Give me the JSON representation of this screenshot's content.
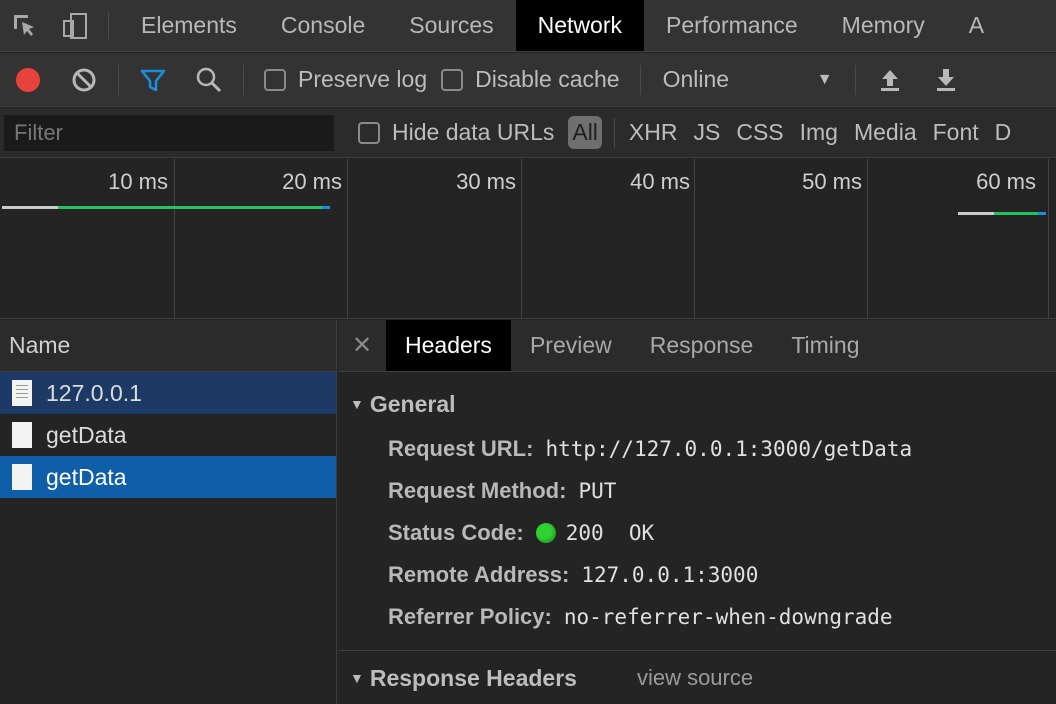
{
  "panels": {
    "tabs": [
      {
        "label": "Elements"
      },
      {
        "label": "Console"
      },
      {
        "label": "Sources"
      },
      {
        "label": "Network",
        "active": true
      },
      {
        "label": "Performance"
      },
      {
        "label": "Memory"
      },
      {
        "label": "A"
      }
    ]
  },
  "toolbar": {
    "record": {
      "icon": "record-icon",
      "color": "#e8433b"
    },
    "clear": {
      "icon": "clear-icon"
    },
    "filter": {
      "icon": "filter-icon",
      "color": "#1a8fe0"
    },
    "search": {
      "icon": "search-icon"
    },
    "preserve_log": {
      "label": "Preserve log",
      "checked": false
    },
    "disable_cache": {
      "label": "Disable cache",
      "checked": false
    },
    "throttling": {
      "value": "Online"
    },
    "import": {
      "icon": "upload-icon"
    },
    "export": {
      "icon": "download-icon"
    }
  },
  "filterbar": {
    "placeholder": "Filter",
    "hide_data_urls": {
      "label": "Hide data URLs",
      "checked": false
    },
    "types": [
      "All",
      "XHR",
      "JS",
      "CSS",
      "Img",
      "Media",
      "Font",
      "D"
    ],
    "active_type": "All"
  },
  "overview": {
    "ticks": [
      "10 ms",
      "20 ms",
      "30 ms",
      "40 ms",
      "50 ms",
      "60 ms"
    ],
    "colors": {
      "waiting": "#cccccc",
      "download": "#21c45f",
      "end": "#1a8fe0"
    }
  },
  "requests": {
    "column": "Name",
    "rows": [
      {
        "name": "127.0.0.1",
        "state": "selected-inactive"
      },
      {
        "name": "getData",
        "state": "normal"
      },
      {
        "name": "getData",
        "state": "selected"
      }
    ]
  },
  "details": {
    "tabs": [
      "Headers",
      "Preview",
      "Response",
      "Timing"
    ],
    "active_tab": "Headers",
    "general": {
      "title": "General",
      "request_url": {
        "key": "Request URL:",
        "value": "http://127.0.0.1:3000/getData"
      },
      "request_method": {
        "key": "Request Method:",
        "value": "PUT"
      },
      "status_code": {
        "key": "Status Code:",
        "value": "200  OK",
        "color": "#2fd32f"
      },
      "remote_address": {
        "key": "Remote Address:",
        "value": "127.0.0.1:3000"
      },
      "referrer_policy": {
        "key": "Referrer Policy:",
        "value": "no-referrer-when-downgrade"
      }
    },
    "response_headers": {
      "title": "Response Headers",
      "view_source": "view source"
    }
  }
}
